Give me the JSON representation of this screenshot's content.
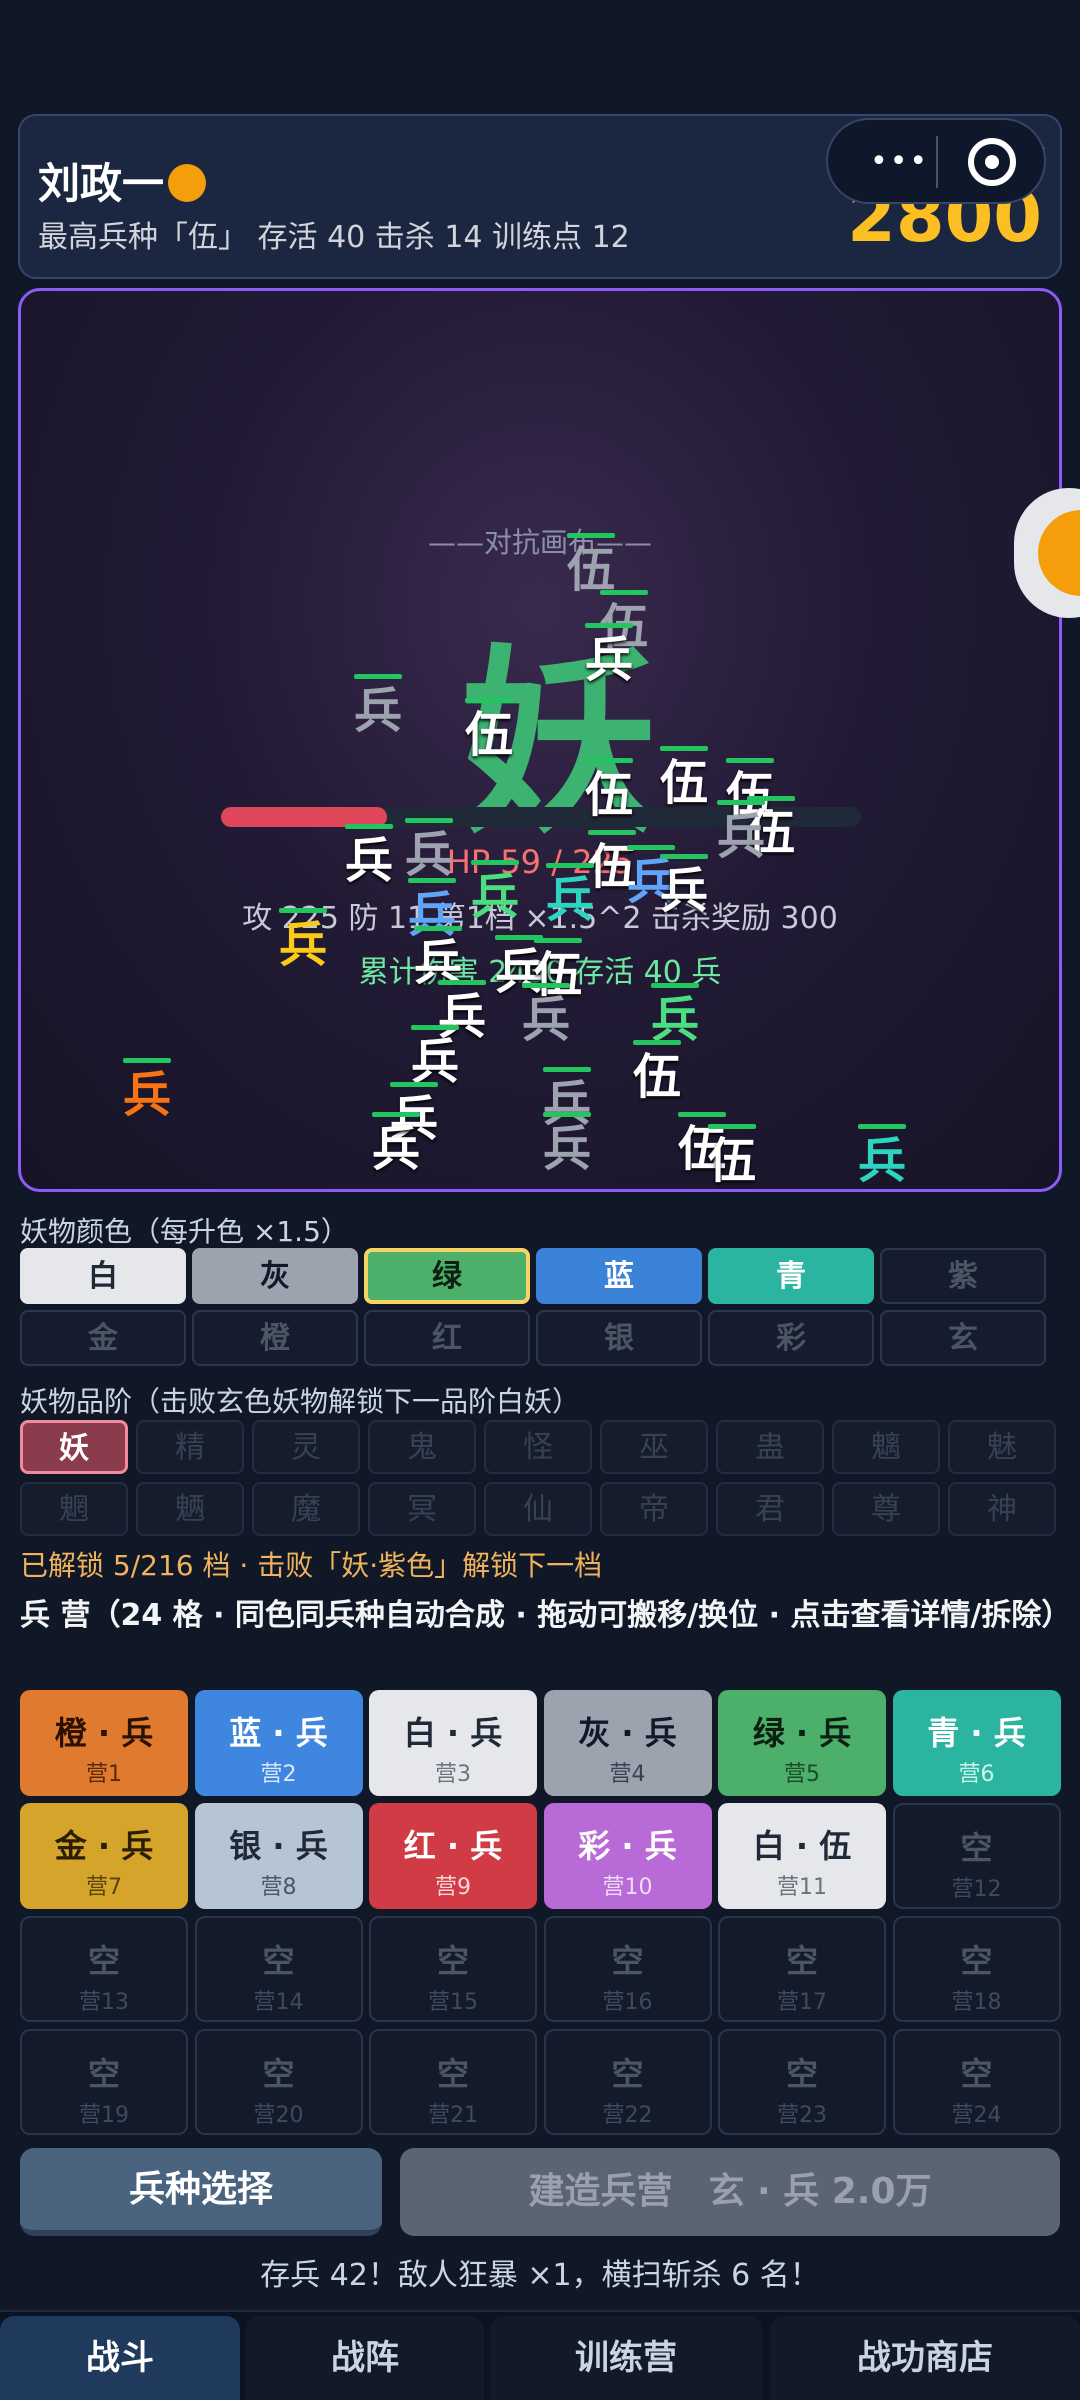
{
  "header": {
    "player_name": "刘政一",
    "stats": "最高兵种「伍」  存活 40  击杀 14  训练点 12",
    "merit_label": "战功",
    "merit_value": "2800"
  },
  "battle": {
    "canvas_label": "——对抗画布——",
    "monster_glyph": "妖",
    "monster_color": "#3cb371",
    "hp_text": "HP 59 / 225",
    "hp_fraction": 0.26,
    "monster_stats": "攻 225  防 11  第1档 ×1.5^2  击杀奖励 300",
    "damage_line": "累计伤害 2430  存活 40 兵",
    "units": [
      {
        "glyph": "伍",
        "color": "gray"
      },
      {
        "glyph": "伍",
        "color": "gray"
      },
      {
        "glyph": "兵",
        "color": "white"
      },
      {
        "glyph": "兵",
        "color": "gray"
      },
      {
        "glyph": "伍",
        "color": "white"
      },
      {
        "glyph": "伍",
        "color": "white"
      },
      {
        "glyph": "伍",
        "color": "white"
      },
      {
        "glyph": "伍",
        "color": "white"
      },
      {
        "glyph": "伍",
        "color": "white"
      },
      {
        "glyph": "兵",
        "color": "gray"
      },
      {
        "glyph": "兵",
        "color": "gray"
      },
      {
        "glyph": "兵",
        "color": "white"
      },
      {
        "glyph": "伍",
        "color": "white"
      },
      {
        "glyph": "兵",
        "color": "blue"
      },
      {
        "glyph": "兵",
        "color": "white"
      },
      {
        "glyph": "兵",
        "color": "green"
      },
      {
        "glyph": "兵",
        "color": "cyan"
      },
      {
        "glyph": "兵",
        "color": "blue"
      },
      {
        "glyph": "兵",
        "color": "gold"
      },
      {
        "glyph": "兵",
        "color": "white"
      },
      {
        "glyph": "兵",
        "color": "white"
      },
      {
        "glyph": "伍",
        "color": "white"
      },
      {
        "glyph": "兵",
        "color": "white"
      },
      {
        "glyph": "兵",
        "color": "white"
      },
      {
        "glyph": "兵",
        "color": "gray"
      },
      {
        "glyph": "兵",
        "color": "green"
      },
      {
        "glyph": "伍",
        "color": "white"
      },
      {
        "glyph": "兵",
        "color": "orange"
      },
      {
        "glyph": "兵",
        "color": "gray"
      },
      {
        "glyph": "兵",
        "color": "white"
      },
      {
        "glyph": "兵",
        "color": "white"
      },
      {
        "glyph": "兵",
        "color": "gray"
      },
      {
        "glyph": "伍",
        "color": "white"
      },
      {
        "glyph": "伍",
        "color": "white"
      },
      {
        "glyph": "兵",
        "color": "cyan"
      }
    ]
  },
  "color_section": {
    "label": "妖物颜色（每升色 ×1.5）",
    "options": [
      {
        "label": "白",
        "state": "unlocked",
        "bg": "#e5e7eb",
        "fg": "#1f2937"
      },
      {
        "label": "灰",
        "state": "unlocked",
        "bg": "#9ca3af",
        "fg": "#111827"
      },
      {
        "label": "绿",
        "state": "selected",
        "bg": "#4caf6a",
        "fg": "#0b1f12"
      },
      {
        "label": "蓝",
        "state": "unlocked",
        "bg": "#3b82d9",
        "fg": "#ffffff"
      },
      {
        "label": "青",
        "state": "unlocked",
        "bg": "#2bb5a0",
        "fg": "#ffffff"
      },
      {
        "label": "紫",
        "state": "locked"
      },
      {
        "label": "金",
        "state": "locked"
      },
      {
        "label": "橙",
        "state": "locked"
      },
      {
        "label": "红",
        "state": "locked"
      },
      {
        "label": "银",
        "state": "locked"
      },
      {
        "label": "彩",
        "state": "locked"
      },
      {
        "label": "玄",
        "state": "locked"
      }
    ]
  },
  "grade_section": {
    "label": "妖物品阶（击败玄色妖物解锁下一品阶白妖）",
    "options": [
      "妖",
      "精",
      "灵",
      "鬼",
      "怪",
      "巫",
      "蛊",
      "魑",
      "魅",
      "魍",
      "魉",
      "魔",
      "冥",
      "仙",
      "帝",
      "君",
      "尊",
      "神"
    ],
    "unlock_text": "已解锁 5/216 档 · 击败「妖·紫色」解锁下一档"
  },
  "barracks": {
    "title": "兵 营（24 格 · 同色同兵种自动合成 · 拖动可搬移/换位 · 点击查看详情/拆除）",
    "camps": [
      {
        "title": "橙 · 兵",
        "sub": "营1",
        "bg": "#e07a2e",
        "fg": "#2a1100",
        "sfg": "#5a2a08"
      },
      {
        "title": "蓝 · 兵",
        "sub": "营2",
        "bg": "#3f86e0",
        "fg": "#ffffff",
        "sfg": "#dbe8fb"
      },
      {
        "title": "白 · 兵",
        "sub": "营3",
        "bg": "#e5e7eb",
        "fg": "#1f2937",
        "sfg": "#6b7280"
      },
      {
        "title": "灰 · 兵",
        "sub": "营4",
        "bg": "#9ca3af",
        "fg": "#111827",
        "sfg": "#374151"
      },
      {
        "title": "绿 · 兵",
        "sub": "营5",
        "bg": "#4caf6a",
        "fg": "#0b1f12",
        "sfg": "#1f4a2b"
      },
      {
        "title": "青 · 兵",
        "sub": "营6",
        "bg": "#2bb5a0",
        "fg": "#ffffff",
        "sfg": "#d0f3ec"
      },
      {
        "title": "金 · 兵",
        "sub": "营7",
        "bg": "#d4a52a",
        "fg": "#2a1d00",
        "sfg": "#5a4408"
      },
      {
        "title": "银 · 兵",
        "sub": "营8",
        "bg": "#b6c5d4",
        "fg": "#1f2937",
        "sfg": "#4b5563"
      },
      {
        "title": "红 · 兵",
        "sub": "营9",
        "bg": "#d13b46",
        "fg": "#ffffff",
        "sfg": "#fbd5d8"
      },
      {
        "title": "彩 · 兵",
        "sub": "营10",
        "bg": "#b86bd6",
        "fg": "#ffffff",
        "sfg": "#f1dcf9"
      },
      {
        "title": "白 · 伍",
        "sub": "营11",
        "bg": "#e5e7eb",
        "fg": "#1f2937",
        "sfg": "#6b7280"
      },
      {
        "title": "空",
        "sub": "营12",
        "empty": true
      },
      {
        "title": "空",
        "sub": "营13",
        "empty": true
      },
      {
        "title": "空",
        "sub": "营14",
        "empty": true
      },
      {
        "title": "空",
        "sub": "营15",
        "empty": true
      },
      {
        "title": "空",
        "sub": "营16",
        "empty": true
      },
      {
        "title": "空",
        "sub": "营17",
        "empty": true
      },
      {
        "title": "空",
        "sub": "营18",
        "empty": true
      },
      {
        "title": "空",
        "sub": "营19",
        "empty": true
      },
      {
        "title": "空",
        "sub": "营20",
        "empty": true
      },
      {
        "title": "空",
        "sub": "营21",
        "empty": true
      },
      {
        "title": "空",
        "sub": "营22",
        "empty": true
      },
      {
        "title": "空",
        "sub": "营23",
        "empty": true
      },
      {
        "title": "空",
        "sub": "营24",
        "empty": true
      }
    ]
  },
  "actions": {
    "select_label": "兵种选择",
    "build_label": "建造兵营　玄 · 兵 2.0万",
    "status": "存兵 42！敌人狂暴 ×1，横扫斩杀 6 名！"
  },
  "nav": {
    "tabs": [
      "战斗",
      "战阵",
      "训练营",
      "战功商店"
    ],
    "active": 0
  }
}
